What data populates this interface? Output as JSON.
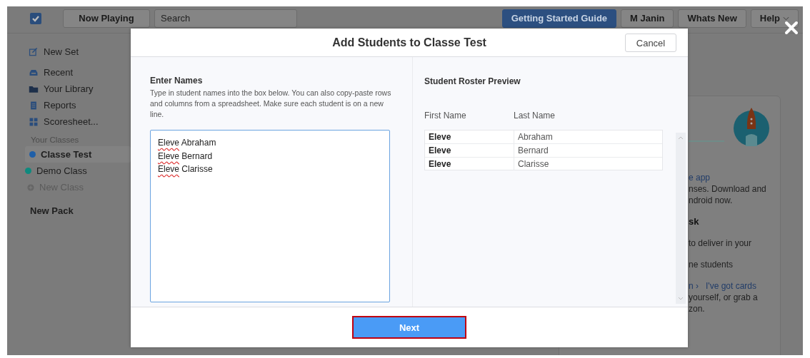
{
  "app": {
    "top_bar": {
      "now_playing": "Now Playing",
      "search": {
        "placeholder": "Search"
      },
      "buttons": [
        {
          "label": "Getting Started Guide",
          "kind": "primary"
        },
        {
          "label": "M Janin",
          "kind": "plain"
        },
        {
          "label": "Whats New",
          "kind": "plain"
        },
        {
          "label": "Help",
          "kind": "menu"
        }
      ]
    },
    "sidebar": {
      "items": [
        {
          "label": "New Set",
          "kind": "new-set"
        },
        {
          "label": "Recent",
          "kind": "recent"
        },
        {
          "label": "Your Library",
          "kind": "library"
        },
        {
          "label": "Reports",
          "kind": "reports"
        },
        {
          "label": "Scoresheet...",
          "kind": "scoresheet"
        },
        {
          "label": "Your Classes",
          "kind": "header"
        },
        {
          "label": "Classe Test",
          "kind": "class",
          "color": "#1f5fa8",
          "selected": true
        },
        {
          "label": "Demo Class",
          "kind": "class",
          "color": "#0e8a7e",
          "selected": false
        },
        {
          "label": "New Class",
          "kind": "add",
          "disabled": true
        },
        {
          "label": "New Pack",
          "kind": "pack"
        }
      ]
    },
    "card": {
      "groups": [
        [
          [
            {
              "text": "e app",
              "kind": "link"
            }
          ],
          [
            {
              "text": "nses. Download and",
              "kind": "text"
            }
          ],
          [
            {
              "text": "ndroid now.",
              "kind": "text"
            }
          ]
        ],
        [
          [
            {
              "text": "sk",
              "kind": "heading"
            }
          ]
        ],
        [
          [
            {
              "text": "to deliver in your",
              "kind": "text"
            }
          ]
        ],
        [
          [
            {
              "text": "ne students",
              "kind": "text"
            }
          ]
        ],
        [
          [
            {
              "text": "n ›",
              "kind": "link"
            },
            {
              "text": "I've got cards",
              "kind": "link"
            }
          ],
          [
            {
              "text": "yourself, or grab a",
              "kind": "text"
            }
          ],
          [
            {
              "text": "zon.",
              "kind": "text"
            }
          ]
        ]
      ]
    }
  },
  "modal": {
    "title": "Add Students to Classe Test",
    "cancel": "Cancel",
    "names_heading": "Enter Names",
    "names_help": "Type in student names into the box below. You can also copy-paste rows and columns from a spreadsheet. Make sure each student is on a new line.",
    "names_value": [
      "Eleve Abraham",
      "Eleve Bernard",
      "Eleve Clarisse"
    ],
    "preview_heading": "Student Roster Preview",
    "table": {
      "columns": [
        "First Name",
        "Last Name"
      ],
      "rows": [
        [
          "Eleve",
          "Abraham"
        ],
        [
          "Eleve",
          "Bernard"
        ],
        [
          "Eleve",
          "Clarisse"
        ]
      ]
    },
    "next": "Next"
  }
}
